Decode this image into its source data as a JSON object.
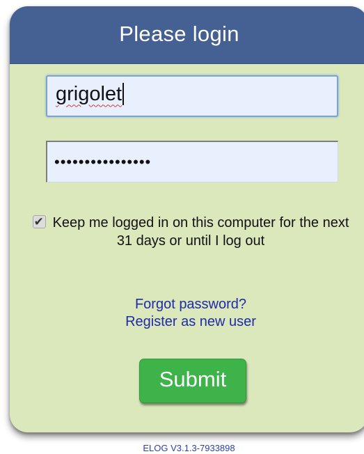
{
  "login": {
    "title": "Please login",
    "username_value": "grigolet",
    "password_mask": "••••••••••••••••",
    "keep_logged_in_checked": true,
    "keep_logged_in_label": "Keep me logged in on this computer for the next 31 days or until I log out",
    "forgot_password_link": "Forgot password?",
    "register_link": "Register as new user",
    "submit_label": "Submit"
  },
  "footer": {
    "version": "ELOG V3.1.3-7933898"
  },
  "colors": {
    "header_bg": "#456092",
    "card_bg": "#dbe8bc",
    "submit_bg": "#3db34a",
    "link": "#1f2aa8",
    "input_bg": "#e8f0fe"
  }
}
